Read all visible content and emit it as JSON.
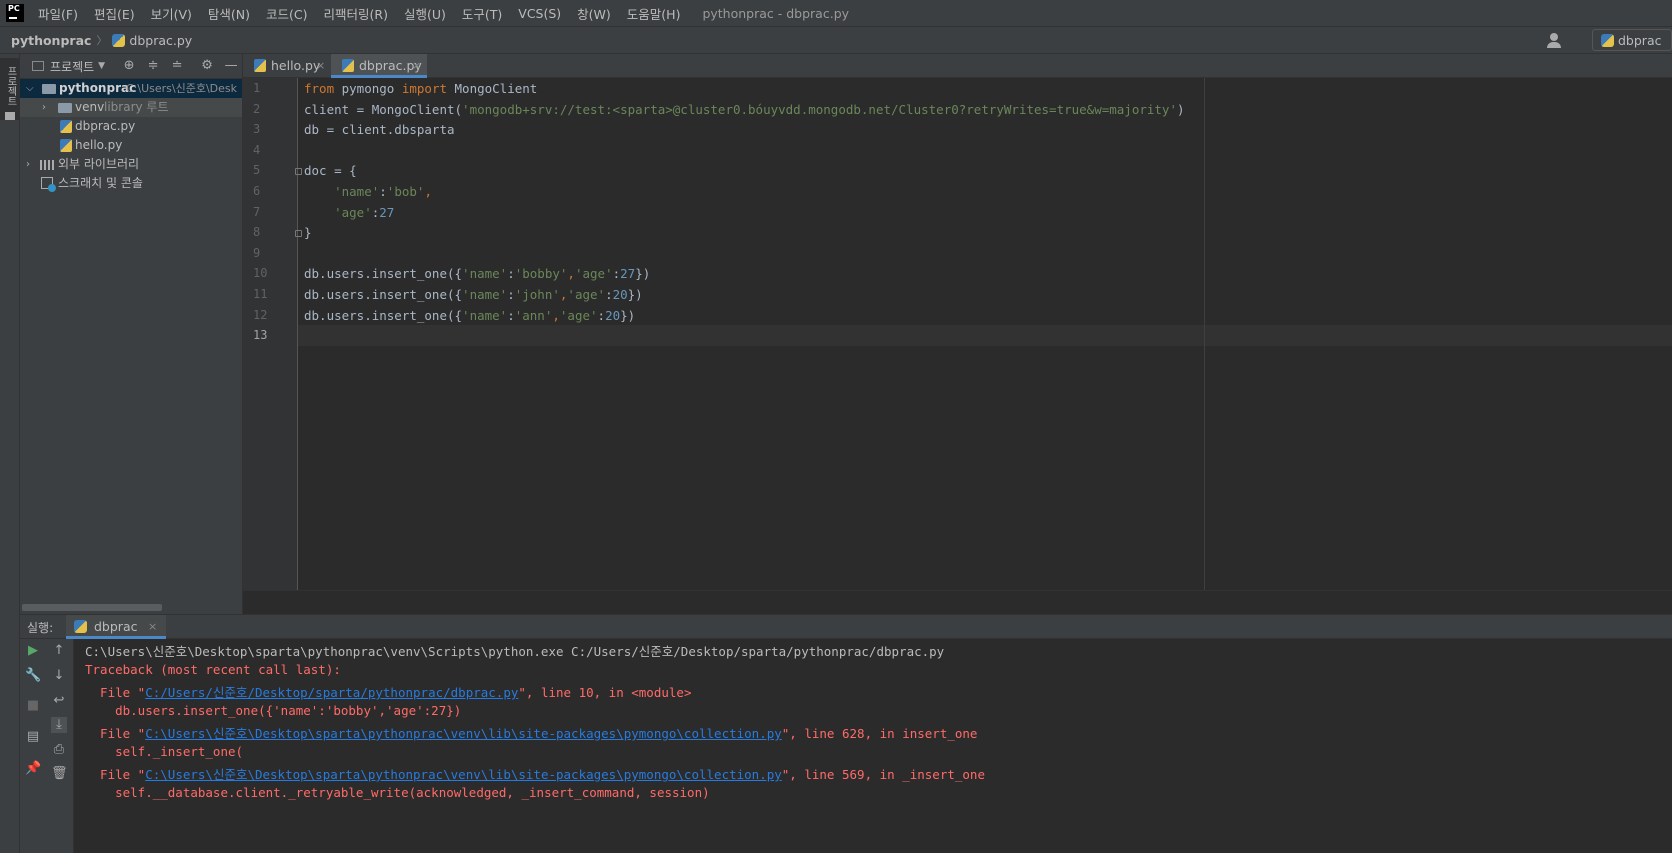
{
  "menubar": {
    "logo_text": "PC",
    "items": [
      "파일(F)",
      "편집(E)",
      "보기(V)",
      "탐색(N)",
      "코드(C)",
      "리팩터링(R)",
      "실행(U)",
      "도구(T)",
      "VCS(S)",
      "창(W)",
      "도움말(H)"
    ],
    "window_title": "pythonprac - dbprac.py"
  },
  "navbar": {
    "project": "pythonprac",
    "separator": "〉",
    "file": "dbprac.py",
    "run_config": "dbprac"
  },
  "left_strip": {
    "project_label": "프로젝트"
  },
  "project_panel": {
    "view_label": "프로젝트",
    "tree": {
      "root_name": "pythonprac",
      "root_path": "C:\\Users\\신준호\\Desk",
      "venv_name": "venv",
      "venv_hint": "library 루트",
      "file1": "dbprac.py",
      "file2": "hello.py",
      "external_libs": "외부 라이브러리",
      "scratches": "스크래치 및 콘솔"
    }
  },
  "tabs": {
    "tab1": "hello.py",
    "tab2": "dbprac.py",
    "close_glyph": "×"
  },
  "editor": {
    "line_numbers": [
      "1",
      "2",
      "3",
      "4",
      "5",
      "6",
      "7",
      "8",
      "9",
      "10",
      "11",
      "12",
      "13"
    ],
    "code": {
      "l1_kw1": "from",
      "l1_mod": " pymongo ",
      "l1_kw2": "import",
      "l1_cls": " MongoClient",
      "l2_pre": "client = MongoClient(",
      "l2_str": "'mongodb+srv://test:<sparta>@cluster0.bóuyvdd.mongodb.net/Cluster0?retryWrites=true&w=majority'",
      "l2_post": ")",
      "l3": "db = client.dbsparta",
      "l5": "doc = {",
      "l6_str1": "'name'",
      "l6_colon": ":",
      "l6_str2": "'bob'",
      "l6_comma": ",",
      "l7_str": "'age'",
      "l7_colon": ":",
      "l7_num": "27",
      "l8": "}",
      "l10_pre": "db.users.insert_one({",
      "l10_s1": "'name'",
      "l10_c1": ":",
      "l10_s2": "'bobby'",
      "l10_cm": ",",
      "l10_s3": "'age'",
      "l10_c2": ":",
      "l10_n": "27",
      "l10_post": "})",
      "l11_pre": "db.users.insert_one({",
      "l11_s1": "'name'",
      "l11_c1": ":",
      "l11_s2": "'john'",
      "l11_cm": ",",
      "l11_s3": "'age'",
      "l11_c2": ":",
      "l11_n": "20",
      "l11_post": "})",
      "l12_pre": "db.users.insert_one({",
      "l12_s1": "'name'",
      "l12_c1": ":",
      "l12_s2": "'ann'",
      "l12_cm": ",",
      "l12_s3": "'age'",
      "l12_c2": ":",
      "l12_n": "20",
      "l12_post": "})"
    }
  },
  "run_panel": {
    "label": "실행:",
    "tab": "dbprac",
    "close_glyph": "×",
    "console": {
      "l1": "C:\\Users\\신준호\\Desktop\\sparta\\pythonprac\\venv\\Scripts\\python.exe C:/Users/신준호/Desktop/sparta/pythonprac/dbprac.py",
      "l2": "Traceback (most recent call last):",
      "l3_pre": "  File \"",
      "l3_link": "C:/Users/신준호/Desktop/sparta/pythonprac/dbprac.py",
      "l3_post": "\", line 10, in <module>",
      "l4": "    db.users.insert_one({'name':'bobby','age':27})",
      "l5_pre": "  File \"",
      "l5_link": "C:\\Users\\신준호\\Desktop\\sparta\\pythonprac\\venv\\lib\\site-packages\\pymongo\\collection.py",
      "l5_post": "\", line 628, in insert_one",
      "l6": "    self._insert_one(",
      "l7_pre": "  File \"",
      "l7_link": "C:\\Users\\신준호\\Desktop\\sparta\\pythonprac\\venv\\lib\\site-packages\\pymongo\\collection.py",
      "l7_post": "\", line 569, in _insert_one",
      "l8": "    self.__database.client._retryable_write(acknowledged, _insert_command, session)"
    }
  },
  "colors": {
    "accent": "#4a88c7",
    "error": "#ff6b68",
    "link": "#287bde",
    "keyword": "#cc7832",
    "string": "#6a8759",
    "number": "#6897bb"
  }
}
